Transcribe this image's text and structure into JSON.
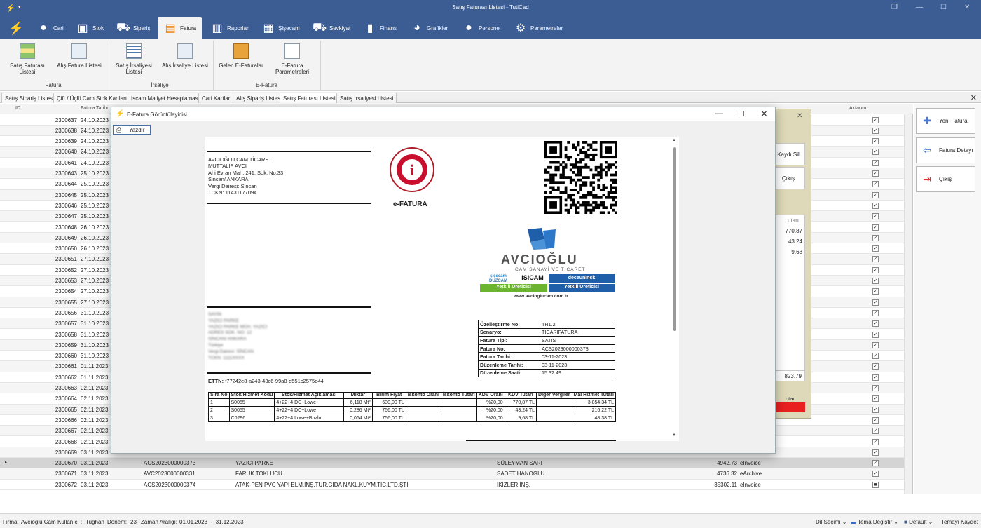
{
  "window": {
    "title": "Satış Faturası Listesi - TutiCad"
  },
  "menu": [
    {
      "label": "Cari",
      "icon": "person-icon"
    },
    {
      "label": "Stok",
      "icon": "box-icon"
    },
    {
      "label": "Sipariş",
      "icon": "order-icon"
    },
    {
      "label": "Fatura",
      "icon": "invoice-icon",
      "active": true
    },
    {
      "label": "Raporlar",
      "icon": "report-icon"
    },
    {
      "label": "Şişecam",
      "icon": "grid-icon"
    },
    {
      "label": "Sevkiyat",
      "icon": "truck-icon"
    },
    {
      "label": "Finans",
      "icon": "bar-chart-icon"
    },
    {
      "label": "Grafikler",
      "icon": "pie-chart-icon"
    },
    {
      "label": "Personel",
      "icon": "staff-icon"
    },
    {
      "label": "Parametreler",
      "icon": "gear-icon"
    }
  ],
  "ribbon": {
    "buttons": [
      {
        "label": "Satış Faturası Listesi"
      },
      {
        "label": "Alış Fatura Listesi"
      },
      {
        "label": "Satış İrsaliyesi Listesi"
      },
      {
        "label": "Alış İrsaliye Listesi"
      },
      {
        "label": "Gelen E-Faturalar"
      },
      {
        "label": "E-Fatura Parametreleri"
      }
    ],
    "groups": [
      "Fatura",
      "İrsaliye",
      "E-Fatura"
    ]
  },
  "doc_tabs": [
    "Satış Sipariş Listesi",
    "Çift / Üçlü Cam Stok Kartları",
    "Iscam Maliyet Hesaplaması",
    "Cari Kartlar",
    "Alış Sipariş Listesi",
    "Satış Faturası Listesi",
    "Satış İrsaliyesi Listesi"
  ],
  "grid": {
    "headers": {
      "id": "ID",
      "date": "Fatura Tarihi",
      "aktarim": "Aktarım"
    },
    "rows": [
      {
        "id": "2300637",
        "date": "24.10.2023"
      },
      {
        "id": "2300638",
        "date": "24.10.2023"
      },
      {
        "id": "2300639",
        "date": "24.10.2023"
      },
      {
        "id": "2300640",
        "date": "24.10.2023"
      },
      {
        "id": "2300641",
        "date": "24.10.2023"
      },
      {
        "id": "2300643",
        "date": "25.10.2023"
      },
      {
        "id": "2300644",
        "date": "25.10.2023"
      },
      {
        "id": "2300645",
        "date": "25.10.2023"
      },
      {
        "id": "2300646",
        "date": "25.10.2023"
      },
      {
        "id": "2300647",
        "date": "25.10.2023"
      },
      {
        "id": "2300648",
        "date": "26.10.2023"
      },
      {
        "id": "2300649",
        "date": "26.10.2023"
      },
      {
        "id": "2300650",
        "date": "26.10.2023"
      },
      {
        "id": "2300651",
        "date": "27.10.2023"
      },
      {
        "id": "2300652",
        "date": "27.10.2023"
      },
      {
        "id": "2300653",
        "date": "27.10.2023"
      },
      {
        "id": "2300654",
        "date": "27.10.2023"
      },
      {
        "id": "2300655",
        "date": "27.10.2023"
      },
      {
        "id": "2300656",
        "date": "31.10.2023"
      },
      {
        "id": "2300657",
        "date": "31.10.2023"
      },
      {
        "id": "2300658",
        "date": "31.10.2023"
      },
      {
        "id": "2300659",
        "date": "31.10.2023"
      },
      {
        "id": "2300660",
        "date": "31.10.2023"
      },
      {
        "id": "2300661",
        "date": "01.11.2023"
      },
      {
        "id": "2300662",
        "date": "01.11.2023"
      },
      {
        "id": "2300663",
        "date": "02.11.2023"
      },
      {
        "id": "2300664",
        "date": "02.11.2023"
      },
      {
        "id": "2300665",
        "date": "02.11.2023"
      },
      {
        "id": "2300666",
        "date": "02.11.2023"
      },
      {
        "id": "2300667",
        "date": "02.11.2023"
      },
      {
        "id": "2300668",
        "date": "02.11.2023"
      },
      {
        "id": "2300669",
        "date": "03.11.2023"
      },
      {
        "id": "2300670",
        "date": "03.11.2023",
        "no": "ACS2023000000373",
        "cari": "YAZICI PARKE",
        "rep": "SÜLEYMAN SARI",
        "amount": "4942.73",
        "type": "eInvoice",
        "selected": true
      },
      {
        "id": "2300671",
        "date": "03.11.2023",
        "no": "AVC2023000000331",
        "cari": "FARUK TOKLUCU",
        "rep": "SADET HANOĞLU",
        "amount": "4736.32",
        "type": "eArchive"
      },
      {
        "id": "2300672",
        "date": "03.11.2023",
        "no": "ACS2023000000374",
        "cari": "ATAK-PEN PVC YAPI ELM.İNŞ.TUR.GIDA NAKL.KUYM.TİC.LTD.ŞTİ",
        "rep": "İKİZLER İNŞ.",
        "amount": "35302.11",
        "type": "eInvoice"
      }
    ]
  },
  "side_buttons": [
    {
      "label": "Yeni Fatura"
    },
    {
      "label": "Fatura Detayı"
    },
    {
      "label": "Çıkış"
    }
  ],
  "back_dialog": {
    "kaydi_sil": "Kaydı Sil",
    "cikis": "Çıkış",
    "col": "utarı",
    "v1": "770.87",
    "v2": "43.24",
    "v3": "9.68",
    "total": "823.79",
    "label": "utar:"
  },
  "status": {
    "firma_label": "Firma:",
    "firma": "Avcıoğlu Cam",
    "kullanici_label": "Kullanıcı :",
    "kullanici": "Tuğhan",
    "donem_label": "Dönem:",
    "donem": "23",
    "aralik_label": "Zaman Aralığı:",
    "aralik": "01.01.2023  -  31.12.2023",
    "dil": "Dil Seçimi",
    "tema": "Tema Değiştir",
    "default": "Default",
    "temayi": "Temayı Kaydet"
  },
  "viewer": {
    "title": "E-Fatura Görüntüleyicisi",
    "print": "Yazdır",
    "seller": [
      "AVCIOĞLU CAM TİCARET",
      "MUTTALİP AVCI",
      "Ahi Evran Mah. 241. Sok. No:33",
      "Sincan/ ANKARA",
      "Vergi Dairesi: Sincan",
      "TCKN: 11431177094"
    ],
    "efatura": "e-FATURA",
    "brand": {
      "name": "AVCIOĞLU",
      "sub": "CAM SANAYİ VE TİCARET",
      "sisecam": "şişecam",
      "duzcam": "DÜZCAM",
      "isicam": "ISICAM",
      "yetkili1": "Yetkili Üreticisi",
      "yetkili2": "Yetkili Üreticisi",
      "deceuninck": "deceuninck",
      "site": "www.avcioglucam.com.tr"
    },
    "buyer_blur": [
      "SAYIN",
      "YAZICI PARKE",
      "YAZICI PARKE MÜH. YAZICI",
      "ADRES SOK. NO: 12",
      "SİNCAN/ ANKARA",
      "Türkiye",
      "Vergi Dairesi: SİNCAN",
      "TCKN: 1111XXXX"
    ],
    "ettn_label": "ETTN:",
    "ettn": "f77242e8-a243-43c6-99a8-d551c2575d44",
    "meta": [
      [
        "Özelleştirme No:",
        "TR1.2"
      ],
      [
        "Senaryo:",
        "TICARIFATURA"
      ],
      [
        "Fatura Tipi:",
        "SATIS"
      ],
      [
        "Fatura No:",
        "ACS2023000000373"
      ],
      [
        "Fatura Tarihi:",
        "03-11-2023"
      ],
      [
        "Düzenleme Tarihi:",
        "03-11-2023"
      ],
      [
        "Düzenleme Saati:",
        "15:32:49"
      ]
    ],
    "items_header": [
      "Sıra No",
      "Stok/Hizmet Kodu",
      "Stok/Hizmet Açıklaması",
      "Miktar",
      "Birim Fiyat",
      "İskonto Oranı",
      "İskonto Tutarı",
      "KDV Oranı",
      "KDV Tutarı",
      "Diğer Vergiler",
      "Mal Hizmet Tutarı"
    ],
    "items": [
      [
        "1",
        "S0055",
        "4+22+4 DC+Lowe",
        "6,118 Mt²",
        "630,00 TL",
        "",
        "",
        "%20,00",
        "770,87 TL",
        "",
        "3.854,34 TL"
      ],
      [
        "2",
        "S0055",
        "4+22+4 DC+Lowe",
        "0,286 Mt²",
        "756,00 TL",
        "",
        "",
        "%20,00",
        "43,24 TL",
        "",
        "216,22 TL"
      ],
      [
        "3",
        "C0296",
        "4+22+4 Lowe+Buzlu",
        "0,064 Mt²",
        "756,00 TL",
        "",
        "",
        "%20,00",
        "9,68 TL",
        "",
        "48,38 TL"
      ]
    ]
  }
}
